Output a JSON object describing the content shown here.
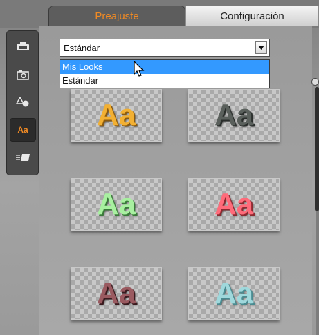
{
  "tabs": {
    "preset": "Preajuste",
    "settings": "Configuración"
  },
  "toolbar": {
    "items": [
      {
        "icon": "video-camera-icon",
        "active": false
      },
      {
        "icon": "photo-camera-icon",
        "active": false
      },
      {
        "icon": "shapes-icon",
        "active": false
      },
      {
        "icon": "text-aa-icon",
        "label": "Aa",
        "active": true
      },
      {
        "icon": "text-lines-icon",
        "active": false
      }
    ]
  },
  "dropdown": {
    "selected": "Estándar",
    "options": [
      "Mis Looks",
      "Estándar"
    ],
    "highlighted": "Mis Looks"
  },
  "presets": [
    {
      "label": "Aa",
      "color": "#f2b033",
      "shadow": "#8a5a10"
    },
    {
      "label": "Aa",
      "color": "#5a605c",
      "shadow": "#2a2e2c"
    },
    {
      "label": "Aa",
      "color": "#a8f0a0",
      "shadow": "#3a7a3a"
    },
    {
      "label": "Aa",
      "color": "#ff6b7a",
      "shadow": "#8a2a30"
    },
    {
      "label": "Aa",
      "color": "#9a5a60",
      "shadow": "#3a1a1e"
    },
    {
      "label": "Aa",
      "color": "#9fd8dc",
      "shadow": "#4a8a90"
    }
  ],
  "colors": {
    "accent": "#f08a24",
    "selection": "#3399ff"
  }
}
